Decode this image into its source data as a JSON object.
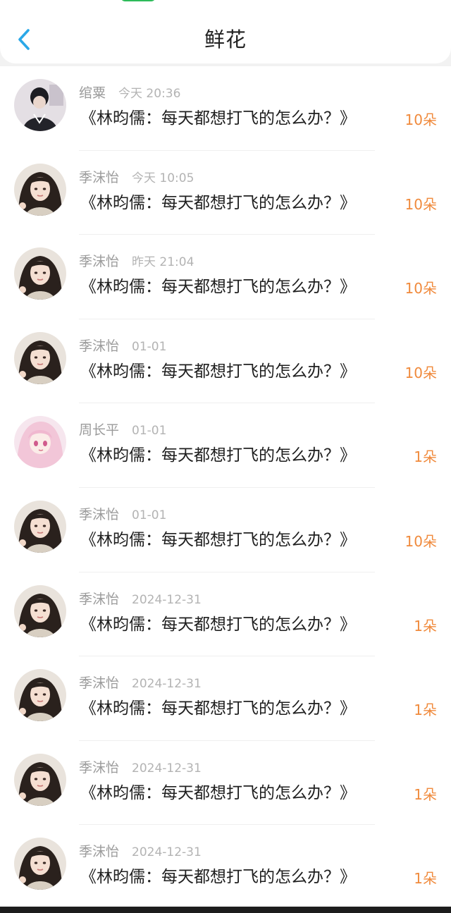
{
  "header": {
    "title": "鲜花",
    "back_icon": "chevron-left-icon",
    "accent_color": "#2aa8e8"
  },
  "colors": {
    "amount": "#f08a3c",
    "meta": "#9b9b9b"
  },
  "gifts": [
    {
      "name": "绾粟",
      "date": "今天 20:36",
      "book": "《林昀儒：每天都想打飞的怎么办？》",
      "amount": "10朵",
      "avatar": "dark-hair-boy"
    },
    {
      "name": "季沫怡",
      "date": "今天 10:05",
      "book": "《林昀儒：每天都想打飞的怎么办？》",
      "amount": "10朵",
      "avatar": "girl-long-hair"
    },
    {
      "name": "季沫怡",
      "date": "昨天 21:04",
      "book": "《林昀儒：每天都想打飞的怎么办？》",
      "amount": "10朵",
      "avatar": "girl-long-hair"
    },
    {
      "name": "季沫怡",
      "date": "01-01",
      "book": "《林昀儒：每天都想打飞的怎么办？》",
      "amount": "10朵",
      "avatar": "girl-long-hair"
    },
    {
      "name": "周长平",
      "date": "01-01",
      "book": "《林昀儒：每天都想打飞的怎么办？》",
      "amount": "1朵",
      "avatar": "anime-pink-girl"
    },
    {
      "name": "季沫怡",
      "date": "01-01",
      "book": "《林昀儒：每天都想打飞的怎么办？》",
      "amount": "10朵",
      "avatar": "girl-long-hair"
    },
    {
      "name": "季沫怡",
      "date": "2024-12-31",
      "book": "《林昀儒：每天都想打飞的怎么办？》",
      "amount": "1朵",
      "avatar": "girl-long-hair"
    },
    {
      "name": "季沫怡",
      "date": "2024-12-31",
      "book": "《林昀儒：每天都想打飞的怎么办？》",
      "amount": "1朵",
      "avatar": "girl-long-hair"
    },
    {
      "name": "季沫怡",
      "date": "2024-12-31",
      "book": "《林昀儒：每天都想打飞的怎么办？》",
      "amount": "1朵",
      "avatar": "girl-long-hair"
    },
    {
      "name": "季沫怡",
      "date": "2024-12-31",
      "book": "《林昀儒：每天都想打飞的怎么办？》",
      "amount": "1朵",
      "avatar": "girl-long-hair"
    }
  ]
}
